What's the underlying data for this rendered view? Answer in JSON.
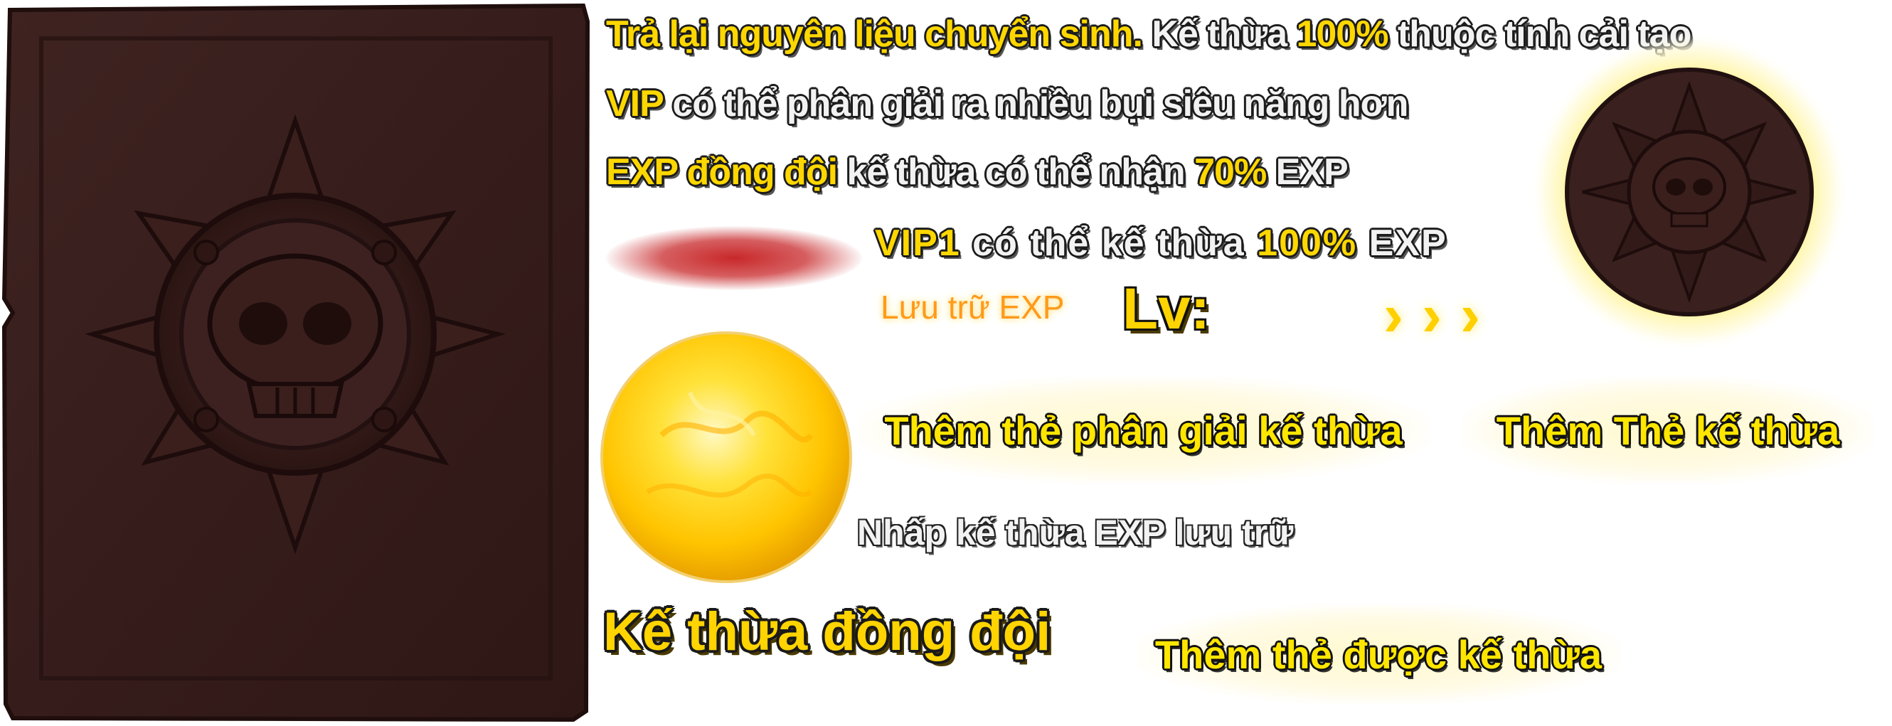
{
  "info_lines": {
    "line1": {
      "a": "Trả lại nguyên liệu chuyển sinh.",
      "b": " Kế thừa ",
      "c": "100%",
      "d": " thuộc tính cải tạo"
    },
    "line2": {
      "a": "VIP",
      "b": " có thể phân giải ra nhiều bụi siêu năng hơn"
    },
    "line3": {
      "a": "EXP đồng đội",
      "b": " kế thừa có thể nhận ",
      "c": "70%",
      "d": " EXP"
    },
    "line4": {
      "a": "VIP1",
      "b": " có thể kế thừa ",
      "c": "100%",
      "d": " EXP"
    }
  },
  "exp_store": {
    "label": "Lưu trữ EXP",
    "level_label": "Lv:",
    "arrows": "›››",
    "click_hint": "Nhấp kế thừa EXP lưu trữ"
  },
  "buttons": {
    "add_decompose_card": "Thêm thẻ phân giải kế thừa",
    "add_inherit_card": "Thêm Thẻ kế thừa",
    "add_inherited_card": "Thêm thẻ được kế thừa"
  },
  "title": "Kế thừa đồng đội",
  "colors": {
    "panel": "#3a1e1c",
    "accent_yellow": "#ffd700",
    "orb": "#ffcc00",
    "red_blur": "#c8282a"
  },
  "icons": {
    "card_slot": "skull-compass-icon",
    "coin_slot": "skull-coin-icon",
    "orb": "exp-orb-icon"
  }
}
